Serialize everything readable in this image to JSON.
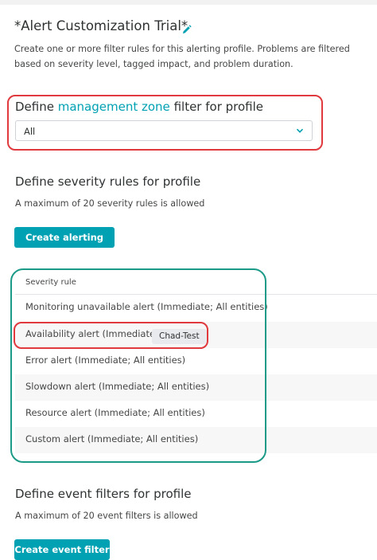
{
  "profile": {
    "title": "*Alert Customization Trial*",
    "description": "Create one or more filter rules for this alerting profile. Problems are filtered based on severity level, tagged impact, and problem duration."
  },
  "management_zone": {
    "heading_prefix": "Define",
    "heading_link": "management zone",
    "heading_suffix": "filter for profile",
    "selected": "All"
  },
  "severity": {
    "heading": "Define severity rules for profile",
    "subtext": "A maximum of 20 severity rules is allowed",
    "button_label": "Create alerting rule",
    "column_header": "Severity rule",
    "rows": [
      "Monitoring unavailable alert (Immediate; All entities)",
      "Availability alert (Immediate;",
      "Error alert (Immediate; All entities)",
      "Slowdown alert (Immediate; All entities)",
      "Resource alert (Immediate; All entities)",
      "Custom alert (Immediate; All entities)"
    ],
    "tooltip": "Chad-Test"
  },
  "events": {
    "heading": "Define event filters for profile",
    "subtext": "A maximum of 20 event filters is allowed",
    "button_label": "Create event filter"
  },
  "colors": {
    "accent": "#00a1b2",
    "highlight_red": "#e0393e",
    "highlight_teal": "#1c9a88"
  },
  "icons": {
    "edit": "pencil-icon",
    "dropdown": "chevron-down-icon"
  }
}
